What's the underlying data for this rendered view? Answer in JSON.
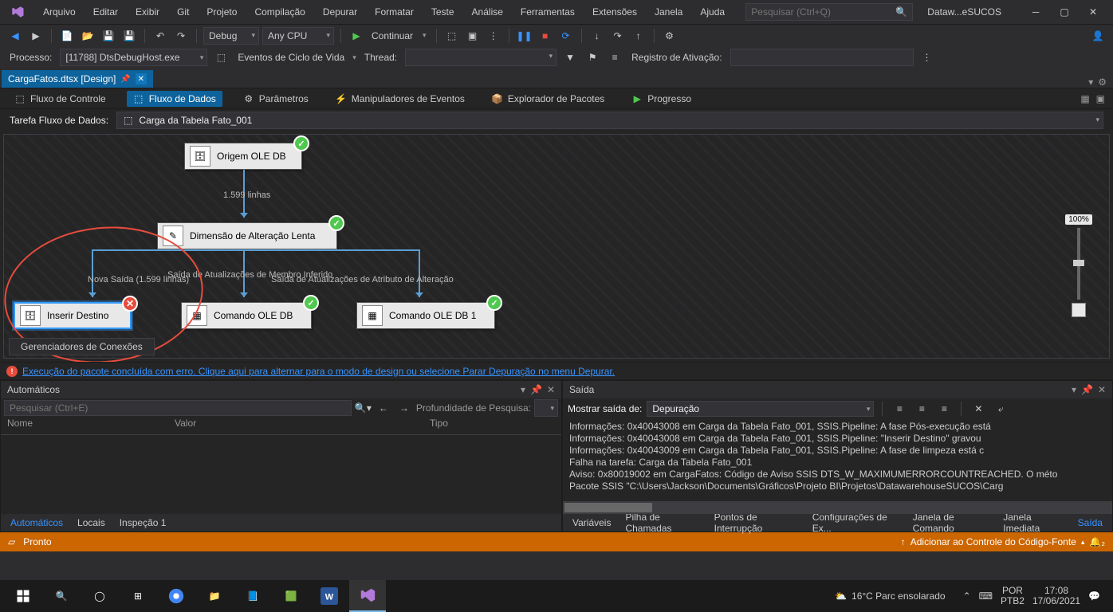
{
  "title_menu": [
    "Arquivo",
    "Editar",
    "Exibir",
    "Git",
    "Projeto",
    "Compilação",
    "Depurar",
    "Formatar",
    "Teste",
    "Análise",
    "Ferramentas",
    "Extensões",
    "Janela",
    "Ajuda"
  ],
  "search_placeholder": "Pesquisar (Ctrl+Q)",
  "solution": "Dataw...eSUCOS",
  "toolbar": {
    "config": "Debug",
    "platform": "Any CPU",
    "continue": "Continuar"
  },
  "proc": {
    "label": "Processo:",
    "value": "[11788] DtsDebugHost.exe",
    "events": "Eventos de Ciclo de Vida",
    "thread": "Thread:",
    "reg": "Registro de Ativação:"
  },
  "doc_tab": "CargaFatos.dtsx [Design]",
  "subtabs": [
    "Fluxo de Controle",
    "Fluxo de Dados",
    "Parâmetros",
    "Manipuladores de Eventos",
    "Explorador de Pacotes",
    "Progresso"
  ],
  "taskbar": {
    "label": "Tarefa Fluxo de Dados:",
    "value": "Carga da Tabela Fato_001"
  },
  "nodes": {
    "origem": "Origem OLE DB",
    "scd": "Dimensão de Alteração Lenta",
    "inserir": "Inserir Destino",
    "cmd1": "Comando OLE DB",
    "cmd2": "Comando OLE DB 1"
  },
  "flow": {
    "rows": "1.599 linhas",
    "nova": "Nova Saída (1.599 linhas)",
    "inf": "Saída de Atualizações de Membro Inferido",
    "attr": "Saída de Atualizações de Atributo de Alteração"
  },
  "conn": "Gerenciadores de Conexões",
  "error_link": "Execução do pacote concluída com erro. Clique aqui para alternar para o modo de design ou selecione Parar Depuração no menu Depurar.",
  "left_panel": {
    "title": "Automáticos",
    "search": "Pesquisar (Ctrl+E)",
    "depth": "Profundidade de Pesquisa:",
    "cols": [
      "Nome",
      "Valor",
      "Tipo"
    ],
    "tabs": [
      "Automáticos",
      "Locais",
      "Inspeção 1"
    ]
  },
  "right_panel": {
    "title": "Saída",
    "show": "Mostrar saída de:",
    "source": "Depuração",
    "lines": [
      "Informações: 0x40043008 em Carga da Tabela Fato_001, SSIS.Pipeline: A fase Pós-execução está",
      "Informações: 0x40043008 em Carga da Tabela Fato_001, SSIS.Pipeline: \"Inserir Destino\" gravou",
      "Informações: 0x40043009 em Carga da Tabela Fato_001, SSIS.Pipeline: A fase de limpeza está c",
      "Falha na tarefa: Carga da Tabela Fato_001",
      "Aviso: 0x80019002 em CargaFatos: Código de Aviso SSIS DTS_W_MAXIMUMERRORCOUNTREACHED. O méto",
      "Pacote SSIS \"C:\\Users\\Jackson\\Documents\\Gráficos\\Projeto BI\\Projetos\\DatawarehouseSUCOS\\Carg"
    ],
    "tabs": [
      "Variáveis",
      "Pilha de Chamadas",
      "Pontos de Interrupção",
      "Configurações de Ex...",
      "Janela de Comando",
      "Janela Imediata",
      "Saída"
    ]
  },
  "status": {
    "ready": "Pronto",
    "source_control": "Adicionar ao Controle do Código-Fonte"
  },
  "taskbar_win": {
    "weather": "16°C  Parc ensolarado",
    "lang": "POR",
    "kbd": "PTB2",
    "time": "17:08",
    "date": "17/06/2021"
  },
  "zoom": "100%"
}
